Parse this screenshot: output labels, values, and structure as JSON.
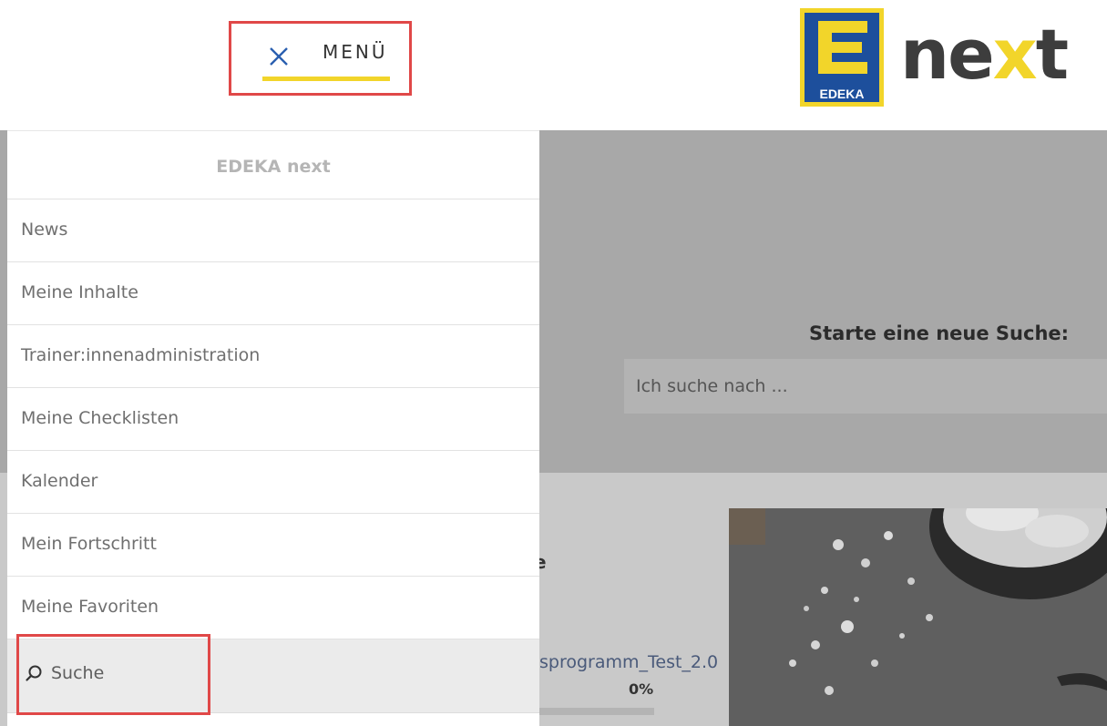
{
  "header": {
    "menu_label": "MENÜ",
    "logo_badge_text": "EDEKA",
    "wordmark_pre": "ne",
    "wordmark_x": "x",
    "wordmark_post": "t"
  },
  "drawer": {
    "title": "EDEKA next",
    "items": [
      {
        "label": "News"
      },
      {
        "label": "Meine Inhalte"
      },
      {
        "label": "Trainer:innenadministration"
      },
      {
        "label": "Meine Checklisten"
      },
      {
        "label": "Kalender"
      },
      {
        "label": "Mein Fortschritt"
      },
      {
        "label": "Meine Favoriten"
      }
    ],
    "search_label": "Suche"
  },
  "background": {
    "search_heading": "Starte eine neue Suche:",
    "search_placeholder": "Ich suche nach ...",
    "partial_heading": "e",
    "course_title": "sprogramm_Test_2.0",
    "course_progress": "0%"
  },
  "colors": {
    "accent_yellow": "#f2d52a",
    "edeka_blue": "#1d4f9c",
    "highlight_red": "#e04848"
  }
}
